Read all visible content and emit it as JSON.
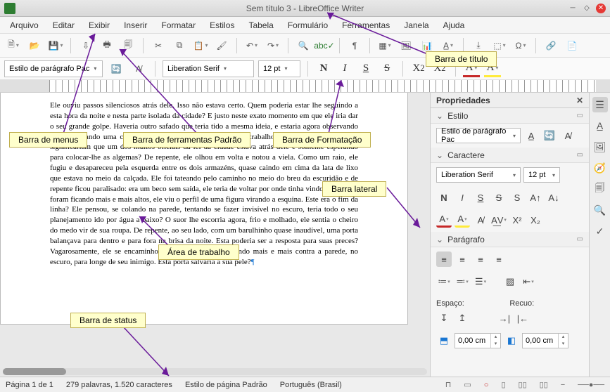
{
  "titlebar": {
    "title": "Sem título 3 - LibreOffice Writer"
  },
  "menu": [
    "Arquivo",
    "Editar",
    "Exibir",
    "Inserir",
    "Formatar",
    "Estilos",
    "Tabela",
    "Formulário",
    "Ferramentas",
    "Janela",
    "Ajuda"
  ],
  "format_bar": {
    "para_style": "Estilo de parágrafo Pac",
    "font": "Liberation Serif",
    "size": "12 pt"
  },
  "document": {
    "text": "Ele ouviu passos silenciosos atrás dele. Isso não estava certo. Quem poderia estar lhe seguindo a esta hora da noite e nesta parte isolada da cidade? E justo neste exato momento em que ele iria dar o seu grande golpe. Haveria outro safado que teria tido a mesma ideia, e estaria agora observando ele e esperando uma chance de se apropriar do fruto de seu trabalho? Ou os passos atrás dele significariam que um dos muitos oficiais da lei da cidade estava atrás dele e somente esperando para colocar-lhe as algemas? De repente, ele olhou em volta e notou a viela. Como um raio, ele fugiu e desapareceu pela esquerda entre os dois armazéns, quase caindo em cima da lata de lixo que estava no meio da calçada. Ele foi tateando pelo caminho no meio do breu da escuridão e de repente ficou paralisado: era um beco sem saída, ele teria de voltar por onde tinha vindo. Os passos foram ficando mais e mais altos, ele viu o perfil de uma figura virando a esquina. Este era o fim da linha? Ele pensou, se colando na parede, tentando se fazer invisível no escuro, teria todo o seu planejamento ido por água a baixo? O suor lhe escorria agora, frio e molhado, ele sentia o cheiro do medo vir de sua roupa. De repente, ao seu lado, com um barulhinho quase inaudível, uma porta balançava para dentro e para fora na brisa da noite. Esta poderia ser a resposta para suas preces? Vagarosamente, ele se encaminhou para a porta, se apertando mais e mais contra a parede, no escuro, para longe de seu inimigo. Esta porta salvaria a sua pele?"
  },
  "sidebar": {
    "title": "Propriedades",
    "style_panel": "Estilo",
    "style_combo": "Estilo de parágrafo Pac",
    "char_panel": "Caractere",
    "font": "Liberation Serif",
    "size": "12 pt",
    "para_panel": "Parágrafo",
    "spacing_label": "Espaço:",
    "indent_label": "Recuo:",
    "zero": "0,00 cm"
  },
  "statusbar": {
    "page": "Página 1 de 1",
    "words": "279 palavras, 1.520 caracteres",
    "pgstyle": "Estilo de página Padrão",
    "lang": "Português (Brasil)"
  },
  "callouts": {
    "title": "Barra de título",
    "menus": "Barra de menus",
    "std_toolbar": "Barra de ferramentas Padrão",
    "fmt_toolbar": "Barra de Formatação",
    "sidebar": "Barra lateral",
    "workarea": "Área de trabalho",
    "status": "Barra de status"
  }
}
